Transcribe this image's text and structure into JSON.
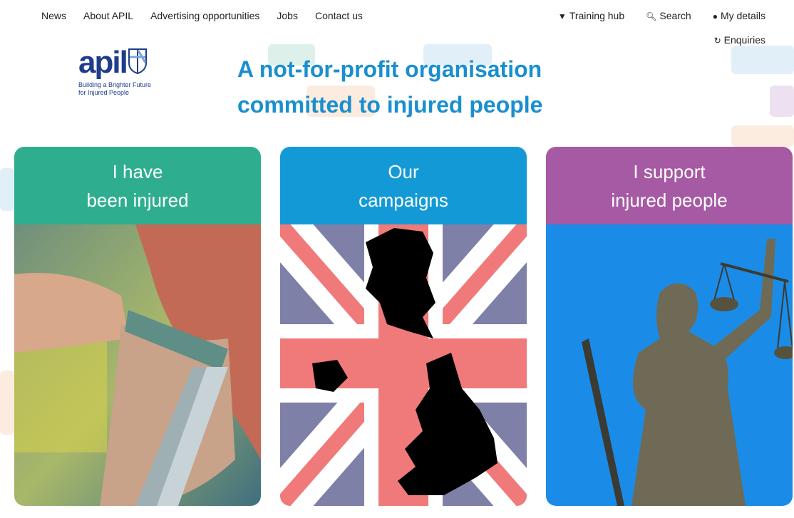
{
  "nav": {
    "items": [
      {
        "label": "News"
      },
      {
        "label": "About APIL"
      },
      {
        "label": "Advertising opportunities"
      },
      {
        "label": "Jobs"
      },
      {
        "label": "Contact us"
      }
    ]
  },
  "utility": {
    "training": {
      "label": "Training hub",
      "icon": "graduation-cap-icon"
    },
    "search": {
      "label": "Search",
      "icon": "search-icon"
    },
    "account": {
      "label": "My details",
      "icon": "user-icon"
    },
    "enquiries": {
      "label": "Enquiries",
      "icon": "refresh-icon"
    }
  },
  "logo": {
    "wordmark": "apil",
    "tagline_line1": "Building a Brighter Future",
    "tagline_line2": "for Injured People",
    "color": "#1f3d8c"
  },
  "hero": {
    "line1": "A not-for-profit organisation",
    "line2": "committed to injured people",
    "color": "#1a8fd0"
  },
  "cards": [
    {
      "line1": "I have",
      "line2": "been injured",
      "color": "#2fae8f",
      "image": "crutch-handshake-photo"
    },
    {
      "line1": "Our",
      "line2": "campaigns",
      "color": "#139ad6",
      "image": "uk-map-union-flag"
    },
    {
      "line1": "I support",
      "line2": "injured people",
      "color": "#a65aa3",
      "image": "lady-justice-statue"
    }
  ]
}
